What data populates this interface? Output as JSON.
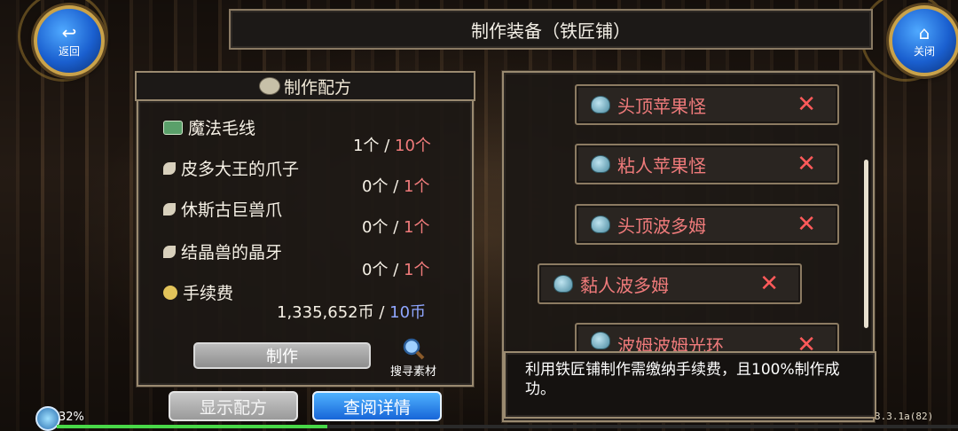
{
  "header": {
    "title": "制作装备（铁匠铺）"
  },
  "nav": {
    "back": {
      "label": "返回",
      "icon": "back-arrow-icon"
    },
    "close": {
      "label": "关闭",
      "icon": "home-icon"
    }
  },
  "recipe": {
    "title": "制作配方",
    "materials": [
      {
        "name": "魔法毛线",
        "have": "1个",
        "sep": "/",
        "need": "10个",
        "icon": "yarn-icon"
      },
      {
        "name": "皮多大王的爪子",
        "have": "0个",
        "sep": "/",
        "need": "1个",
        "icon": "claw-icon"
      },
      {
        "name": "休斯古巨兽爪",
        "have": "0个",
        "sep": "/",
        "need": "1个",
        "icon": "claw-icon"
      },
      {
        "name": "结晶兽的晶牙",
        "have": "0个",
        "sep": "/",
        "need": "1个",
        "icon": "claw-icon"
      }
    ],
    "fee": {
      "name": "手续费",
      "have": "1,335,652币",
      "sep": "/",
      "need": "10币",
      "icon": "coins-icon"
    },
    "craft_label": "制作",
    "search_label": "搜寻素材"
  },
  "buttons": {
    "show_recipe": "显示配方",
    "view_details": "查阅详情"
  },
  "sources": [
    {
      "name": "头顶苹果怪"
    },
    {
      "name": "粘人苹果怪"
    },
    {
      "name": "头顶波多姆"
    },
    {
      "name": "黏人波多姆"
    },
    {
      "name": "波姆波姆光环"
    }
  ],
  "info": {
    "text": "利用铁匠铺制作需缴纳手续费，且100%制作成功。"
  },
  "status": {
    "percent": "32%",
    "version": "3.3.1a(82)",
    "exp_fraction": 0.3
  },
  "colors": {
    "need_red": "#f07b7b",
    "need_blue": "#8fa6ff",
    "close_x": "#ff5a5a",
    "accent_blue": "#1765d8"
  }
}
